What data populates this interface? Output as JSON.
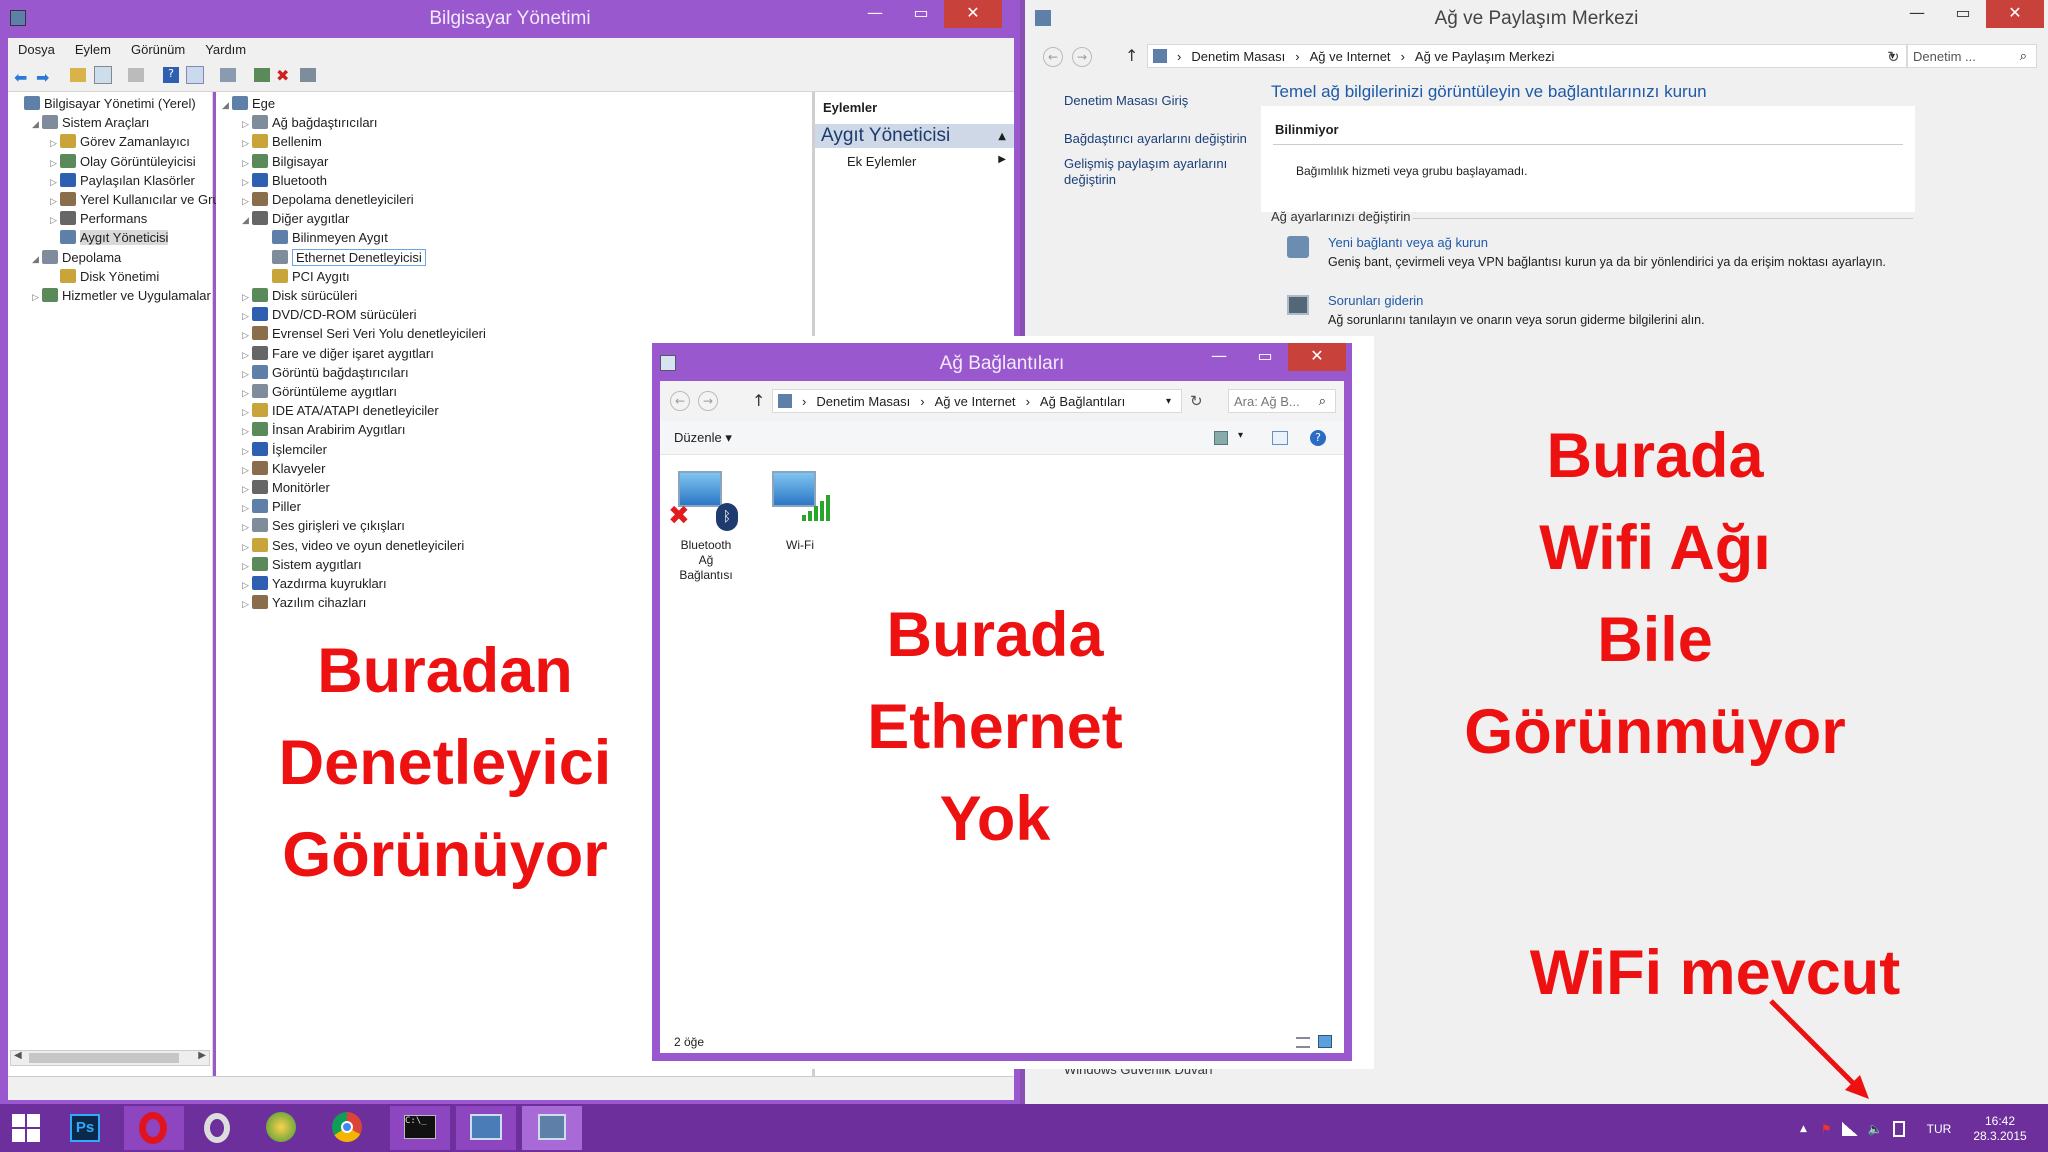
{
  "computer_mgmt": {
    "title": "Bilgisayar Yönetimi",
    "menu": [
      "Dosya",
      "Eylem",
      "Görünüm",
      "Yardım"
    ],
    "left_tree": [
      {
        "label": "Bilgisayar Yönetimi (Yerel)",
        "level": 0,
        "arrow": ""
      },
      {
        "label": "Sistem Araçları",
        "level": 1,
        "arrow": "◢"
      },
      {
        "label": "Görev Zamanlayıcı",
        "level": 2,
        "arrow": "▷"
      },
      {
        "label": "Olay Görüntüleyicisi",
        "level": 2,
        "arrow": "▷"
      },
      {
        "label": "Paylaşılan Klasörler",
        "level": 2,
        "arrow": "▷"
      },
      {
        "label": "Yerel Kullanıcılar ve Gru",
        "level": 2,
        "arrow": "▷"
      },
      {
        "label": "Performans",
        "level": 2,
        "arrow": "▷"
      },
      {
        "label": "Aygıt Yöneticisi",
        "level": 2,
        "arrow": "",
        "selected": true
      },
      {
        "label": "Depolama",
        "level": 1,
        "arrow": "◢"
      },
      {
        "label": "Disk Yönetimi",
        "level": 2,
        "arrow": ""
      },
      {
        "label": "Hizmetler ve Uygulamalar",
        "level": 1,
        "arrow": "▷"
      }
    ],
    "device_tree": [
      {
        "label": "Ege",
        "level": 0,
        "arrow": "◢"
      },
      {
        "label": "Ağ bağdaştırıcıları",
        "level": 1,
        "arrow": "▷"
      },
      {
        "label": "Bellenim",
        "level": 1,
        "arrow": "▷"
      },
      {
        "label": "Bilgisayar",
        "level": 1,
        "arrow": "▷"
      },
      {
        "label": "Bluetooth",
        "level": 1,
        "arrow": "▷"
      },
      {
        "label": "Depolama denetleyicileri",
        "level": 1,
        "arrow": "▷"
      },
      {
        "label": "Diğer aygıtlar",
        "level": 1,
        "arrow": "◢"
      },
      {
        "label": "Bilinmeyen Aygıt",
        "level": 2,
        "arrow": ""
      },
      {
        "label": "Ethernet Denetleyicisi",
        "level": 2,
        "arrow": "",
        "selected": true
      },
      {
        "label": "PCI Aygıtı",
        "level": 2,
        "arrow": ""
      },
      {
        "label": "Disk sürücüleri",
        "level": 1,
        "arrow": "▷"
      },
      {
        "label": "DVD/CD-ROM sürücüleri",
        "level": 1,
        "arrow": "▷"
      },
      {
        "label": "Evrensel Seri Veri Yolu denetleyicileri",
        "level": 1,
        "arrow": "▷"
      },
      {
        "label": "Fare ve diğer işaret aygıtları",
        "level": 1,
        "arrow": "▷"
      },
      {
        "label": "Görüntü bağdaştırıcıları",
        "level": 1,
        "arrow": "▷"
      },
      {
        "label": "Görüntüleme aygıtları",
        "level": 1,
        "arrow": "▷"
      },
      {
        "label": "IDE ATA/ATAPI denetleyiciler",
        "level": 1,
        "arrow": "▷"
      },
      {
        "label": "İnsan Arabirim Aygıtları",
        "level": 1,
        "arrow": "▷"
      },
      {
        "label": "İşlemciler",
        "level": 1,
        "arrow": "▷"
      },
      {
        "label": "Klavyeler",
        "level": 1,
        "arrow": "▷"
      },
      {
        "label": "Monitörler",
        "level": 1,
        "arrow": "▷"
      },
      {
        "label": "Piller",
        "level": 1,
        "arrow": "▷"
      },
      {
        "label": "Ses girişleri ve çıkışları",
        "level": 1,
        "arrow": "▷"
      },
      {
        "label": "Ses, video ve oyun denetleyicileri",
        "level": 1,
        "arrow": "▷"
      },
      {
        "label": "Sistem aygıtları",
        "level": 1,
        "arrow": "▷"
      },
      {
        "label": "Yazdırma kuyrukları",
        "level": 1,
        "arrow": "▷"
      },
      {
        "label": "Yazılım cihazları",
        "level": 1,
        "arrow": "▷"
      }
    ],
    "actions": {
      "header": "Eylemler",
      "section": "Aygıt Yöneticisi",
      "item": "Ek Eylemler"
    }
  },
  "network_center": {
    "title": "Ağ ve Paylaşım Merkezi",
    "breadcrumb": [
      "Denetim Masası",
      "Ağ ve Internet",
      "Ağ ve Paylaşım Merkezi"
    ],
    "search_placeholder": "Denetim ...",
    "side_links": [
      "Denetim Masası Giriş",
      "Bağdaştırıcı ayarlarını değiştirin",
      "Gelişmiş paylaşım ayarlarını değiştirin"
    ],
    "heading": "Temel ağ bilgilerinizi görüntüleyin ve bağlantılarınızı kurun",
    "box_title": "Bilinmiyor",
    "box_msg": "Bağımlılık hizmeti veya grubu başlayamadı.",
    "change_header": "Ağ ayarlarınızı değiştirin",
    "task1_title": "Yeni bağlantı veya ağ kurun",
    "task1_desc": "Geniş bant, çevirmeli veya VPN bağlantısı kurun ya da bir yönlendirici ya da erişim noktası ayarlayın.",
    "task2_title": "Sorunları giderin",
    "task2_desc": "Ağ sorunlarını tanılayın ve onarın veya sorun giderme bilgilerini alın.",
    "footer_link": "Windows Güvenlik Duvarı"
  },
  "net_connections": {
    "title": "Ağ Bağlantıları",
    "breadcrumb": [
      "Denetim Masası",
      "Ağ ve Internet",
      "Ağ Bağlantıları"
    ],
    "search_placeholder": "Ara: Ağ B...",
    "organize": "Düzenle",
    "items": [
      {
        "line1": "Bluetooth",
        "line2": "Ağ",
        "line3": "Bağlantısı"
      },
      {
        "line1": "Wi-Fi"
      }
    ],
    "status": "2 öğe"
  },
  "annotations": {
    "left": [
      "Buradan",
      "Denetleyici",
      "Görünüyor"
    ],
    "center": [
      "Burada",
      "Ethernet",
      "Yok"
    ],
    "right": [
      "Burada",
      "Wifi Ağı",
      "Bile",
      "Görünmüyor"
    ],
    "bottom": "WiFi mevcut",
    "color": "#ee1111"
  },
  "taskbar": {
    "apps": [
      "start-icon",
      "photoshop-icon",
      "opera-icon",
      "opera-next-icon",
      "network-globe-icon",
      "chrome-icon",
      "cmd-icon",
      "remote-desktop-icon",
      "computer-mgmt-icon"
    ],
    "ps_label": "Ps",
    "lang": "TUR",
    "time": "16:42",
    "date": "28.3.2015"
  },
  "colors": {
    "accent": "#9251c8",
    "taskbar": "#6c2f9b",
    "close": "#c8413b"
  }
}
